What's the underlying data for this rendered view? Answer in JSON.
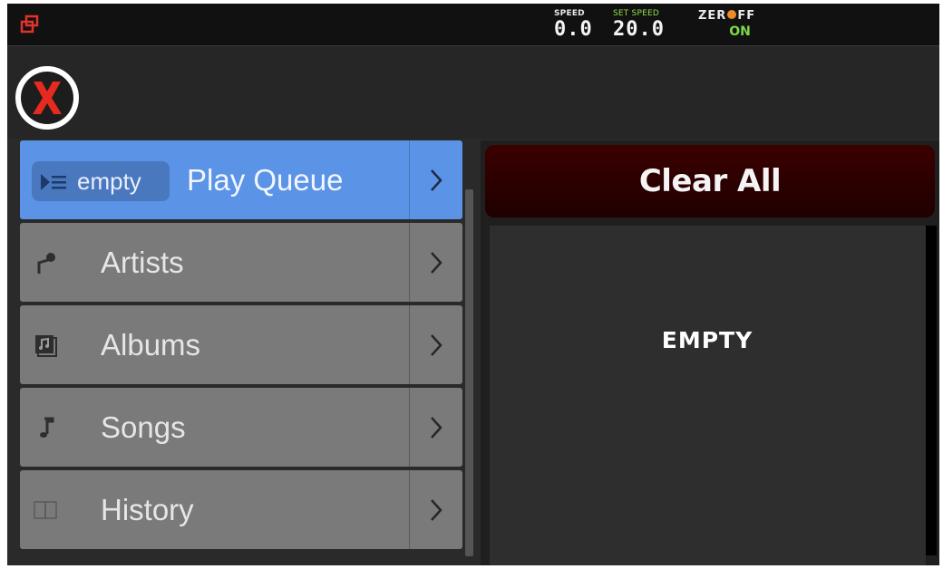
{
  "status": {
    "speed_label": "SPEED",
    "speed_value": "0.0",
    "set_speed_label": "SET SPEED",
    "set_speed_value": "20.0",
    "zero_off_left": "ZER",
    "zero_off_right": "FF",
    "zero_off_state": "ON",
    "accent": "#8ee04a"
  },
  "nav": {
    "items": [
      {
        "label": "Play Queue",
        "badge": "empty",
        "icon": "play-queue-icon"
      },
      {
        "label": "Artists",
        "icon": "microphone-icon"
      },
      {
        "label": "Albums",
        "icon": "album-icon"
      },
      {
        "label": "Songs",
        "icon": "music-note-icon"
      },
      {
        "label": "History",
        "icon": "book-icon"
      }
    ]
  },
  "panel": {
    "clear_all_label": "Clear All",
    "empty_label": "EMPTY"
  }
}
